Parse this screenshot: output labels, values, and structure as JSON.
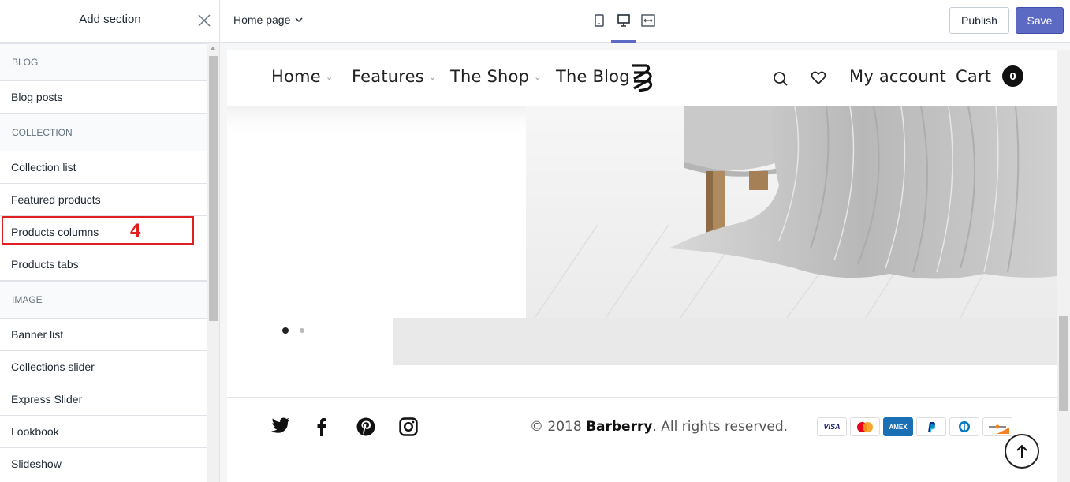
{
  "panel": {
    "title": "Add section"
  },
  "toolbar": {
    "page_select": "Home page",
    "devices": [
      "mobile-icon",
      "desktop-icon",
      "fullwidth-icon"
    ],
    "active_device": "desktop",
    "publish_label": "Publish",
    "save_label": "Save",
    "accent": "#5c6ac4"
  },
  "sidebar": {
    "groups": [
      {
        "heading": "BLOG",
        "items": [
          "Blog posts"
        ]
      },
      {
        "heading": "COLLECTION",
        "items": [
          "Collection list",
          "Featured products",
          "Products columns",
          "Products tabs"
        ]
      },
      {
        "heading": "IMAGE",
        "items": [
          "Banner list",
          "Collections slider",
          "Express Slider",
          "Lookbook",
          "Slideshow"
        ]
      }
    ],
    "highlight_label": "4"
  },
  "store": {
    "nav": [
      "Home",
      "Features",
      "The Shop",
      "The Blog"
    ],
    "account": "My account",
    "cart_label": "Cart",
    "cart_count": "0",
    "slider_dots": 2,
    "active_dot": 1
  },
  "footer": {
    "copyright_prefix": "© 2018 ",
    "brand": "Barberry",
    "copyright_suffix": ". All rights reserved.",
    "social": [
      "twitter-icon",
      "facebook-icon",
      "pinterest-icon",
      "instagram-icon"
    ],
    "payments": [
      "VISA",
      "mastercard",
      "AMEX",
      "PayPal",
      "diners",
      "discover"
    ]
  }
}
